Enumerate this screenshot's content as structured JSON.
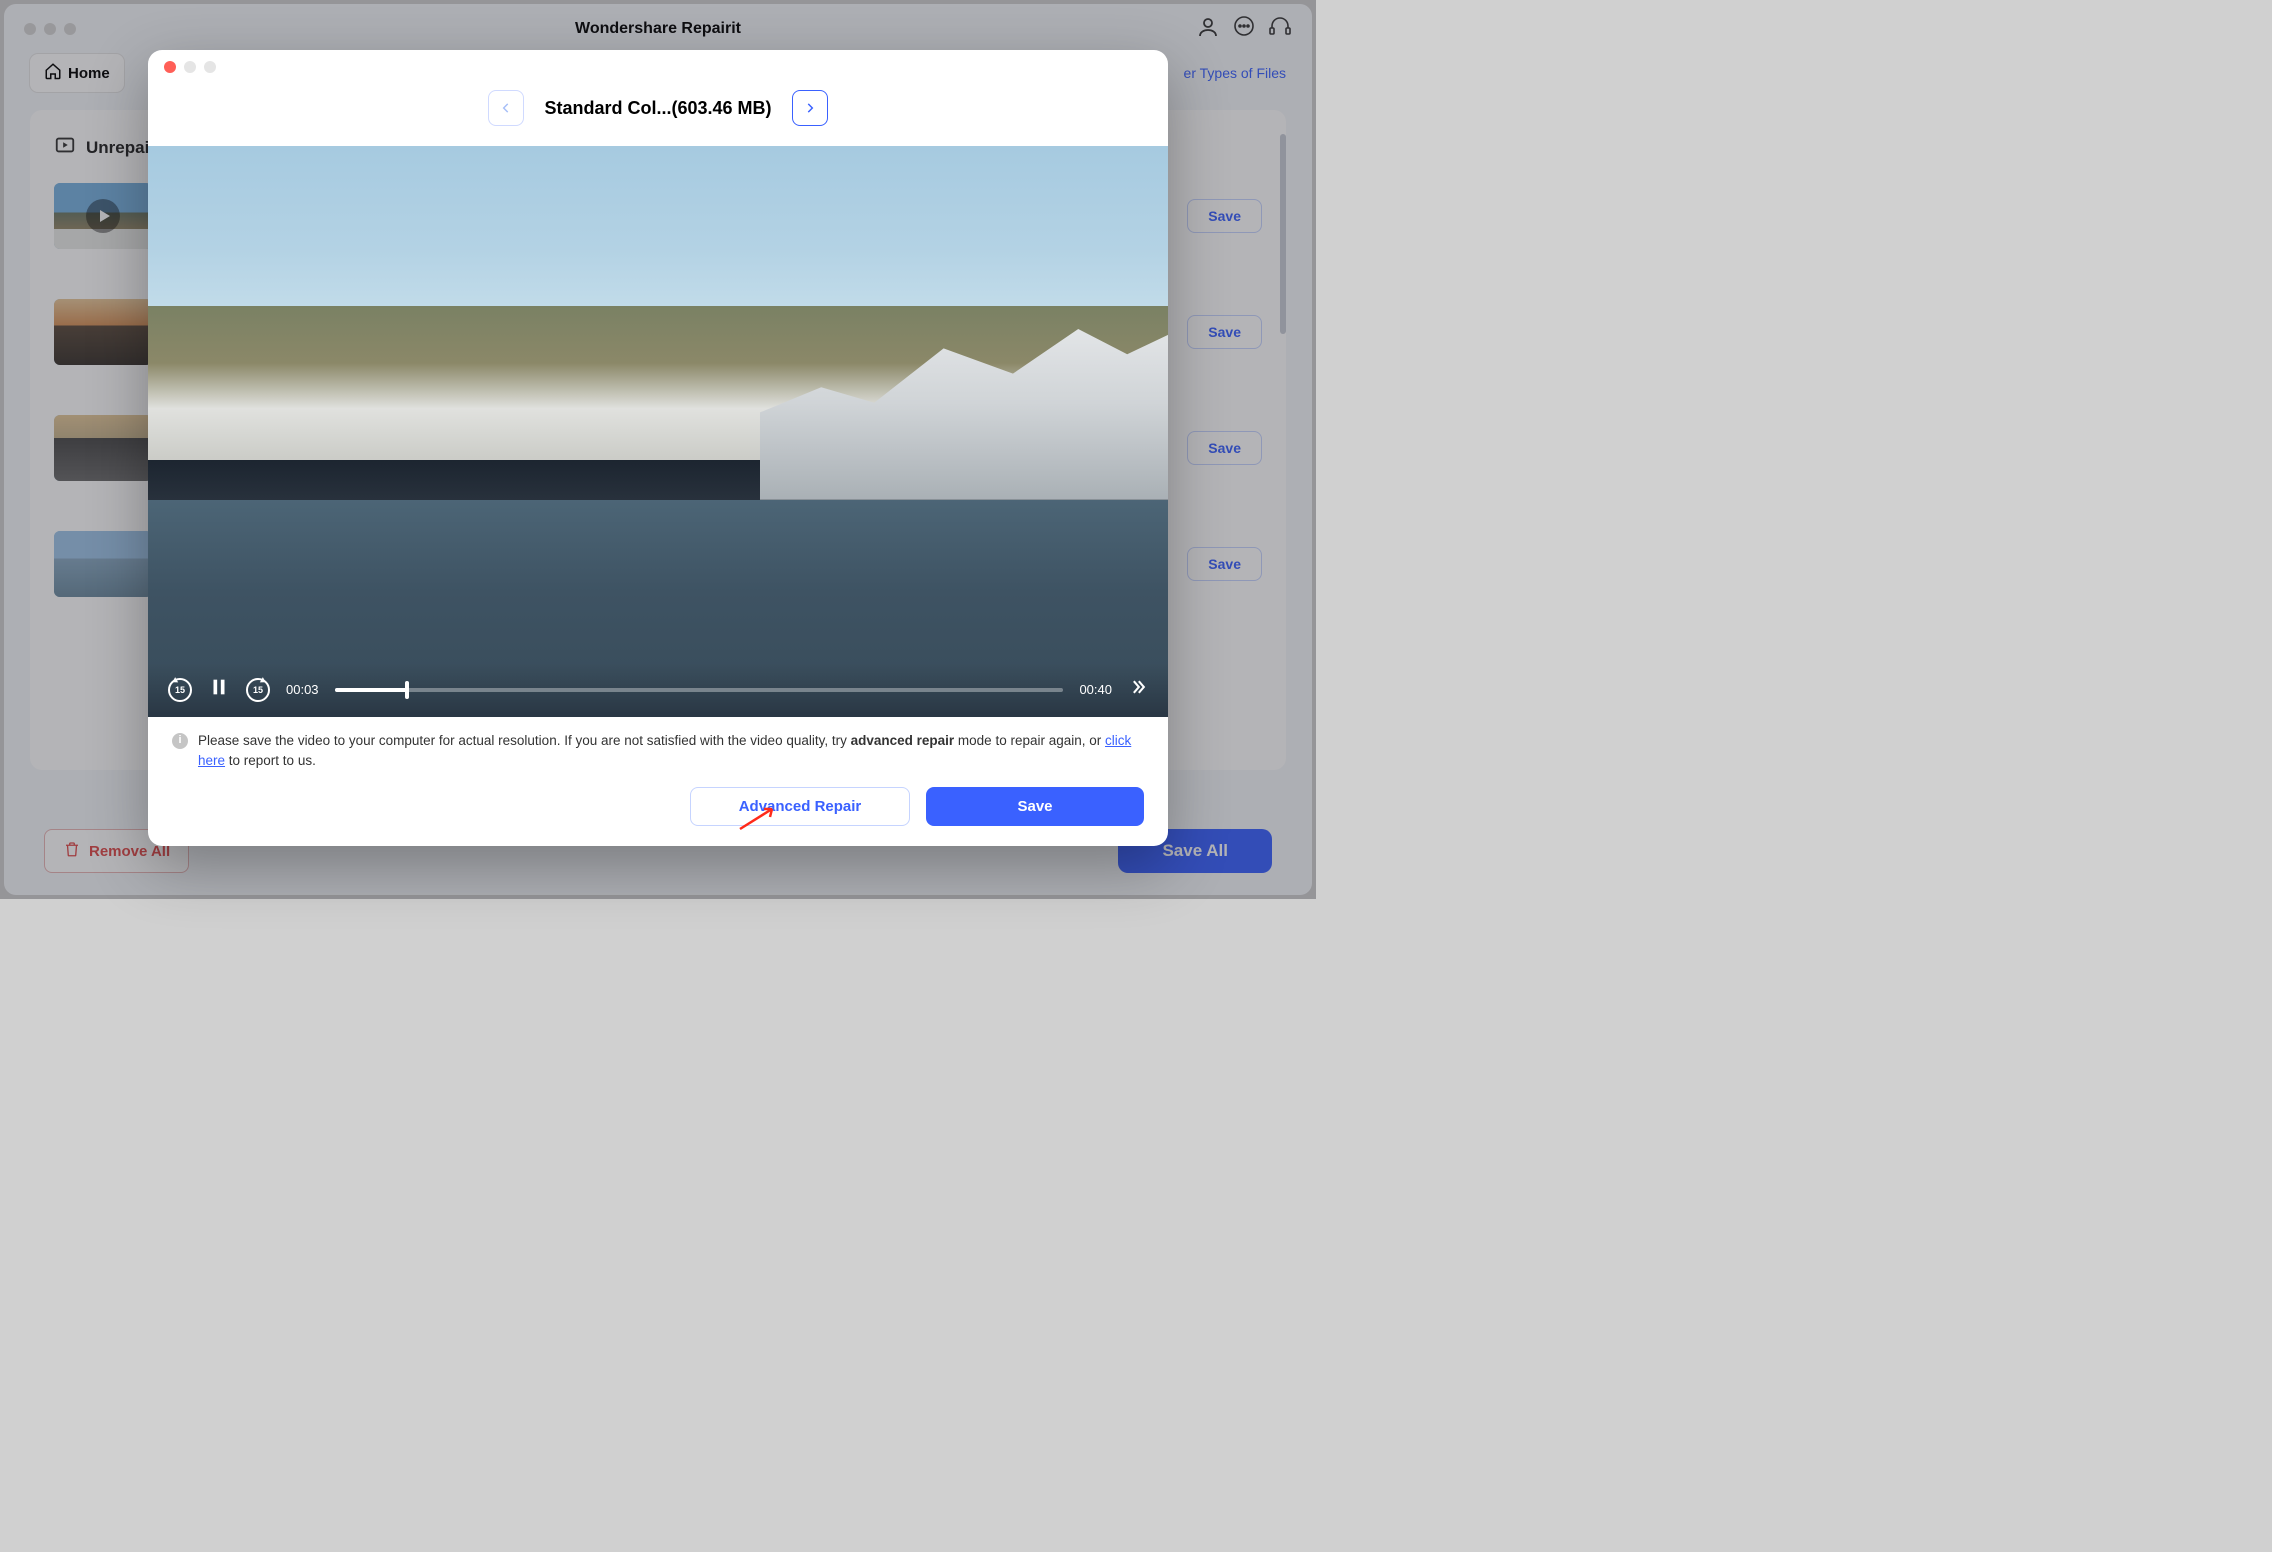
{
  "bg": {
    "title": "Wondershare Repairit",
    "home": "Home",
    "other_types": "er Types of Files",
    "section": "Unrepai",
    "save": "Save",
    "remove_all": "Remove All",
    "save_all": "Save All"
  },
  "modal": {
    "file_title": "Standard Col...(603.46 MB)",
    "cur_time": "00:03",
    "total_time": "00:40",
    "skip_label": "15",
    "info_prefix": "Please save the video to your computer for actual resolution. If you are not satisfied with the video quality, try ",
    "info_bold": "advanced repair",
    "info_mid": " mode to repair again, or ",
    "info_link": "click here",
    "info_suffix": " to report to us.",
    "advanced_repair": "Advanced Repair",
    "save": "Save"
  }
}
